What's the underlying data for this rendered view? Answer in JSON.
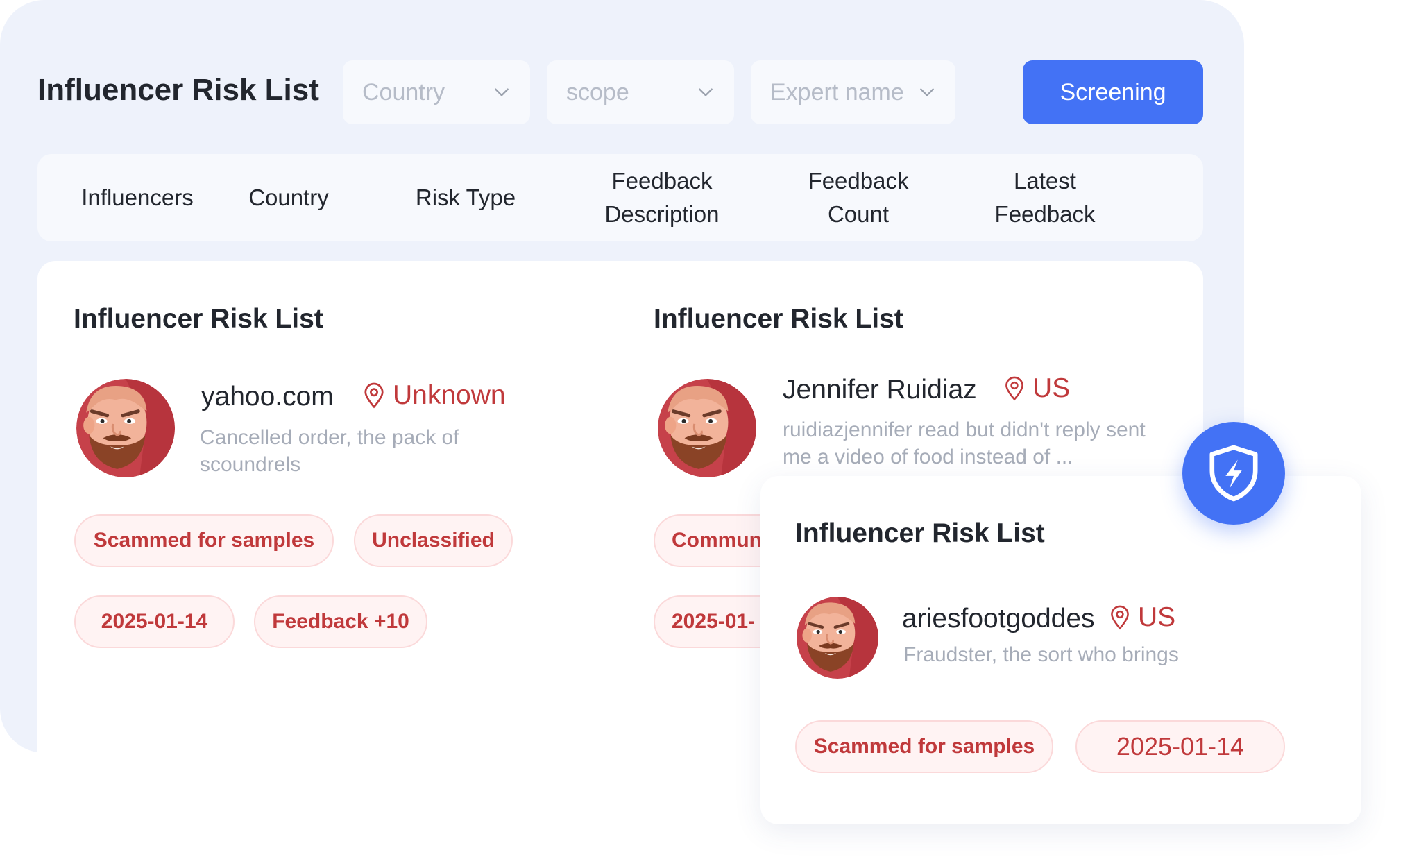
{
  "page": {
    "title": "Influencer Risk List"
  },
  "filters": {
    "country_placeholder": "Country",
    "scope_placeholder": "scope",
    "expert_placeholder": "Expert name",
    "screening_label": "Screening"
  },
  "table_header": {
    "columns": [
      "Influencers",
      "Country",
      "Risk Type",
      "Feedback\nDescription",
      "Feedback\nCount",
      "Latest\nFeedback"
    ]
  },
  "cards": [
    {
      "title": "Influencer Risk List",
      "name": "yahoo.com",
      "location": "Unknown",
      "description": "Cancelled order, the pack of scoundrels",
      "tags": [
        "Scammed for samples",
        "Unclassified",
        "2025-01-14",
        "Feedback +10"
      ]
    },
    {
      "title": "Influencer Risk List",
      "name": "Jennifer Ruidiaz",
      "location": "US",
      "description": "ruidiazjennifer read but didn't reply sent me a video of food instead of ...",
      "tags": [
        "Commun",
        "2025-01-"
      ]
    }
  ],
  "popup": {
    "title": "Influencer Risk List",
    "name": "ariesfootgoddes",
    "location": "US",
    "description": "Fraudster, the sort who brings",
    "tags": [
      "Scammed for samples",
      "2025-01-14"
    ]
  },
  "colors": {
    "accent": "#4372f5",
    "risk_red": "#c0393b",
    "tag_bg": "#fff3f3",
    "panel_bg": "#eef2fb"
  },
  "icons": {
    "dropdown": "chevron-down-icon",
    "location": "map-pin-icon",
    "badge": "shield-lightning-icon"
  }
}
